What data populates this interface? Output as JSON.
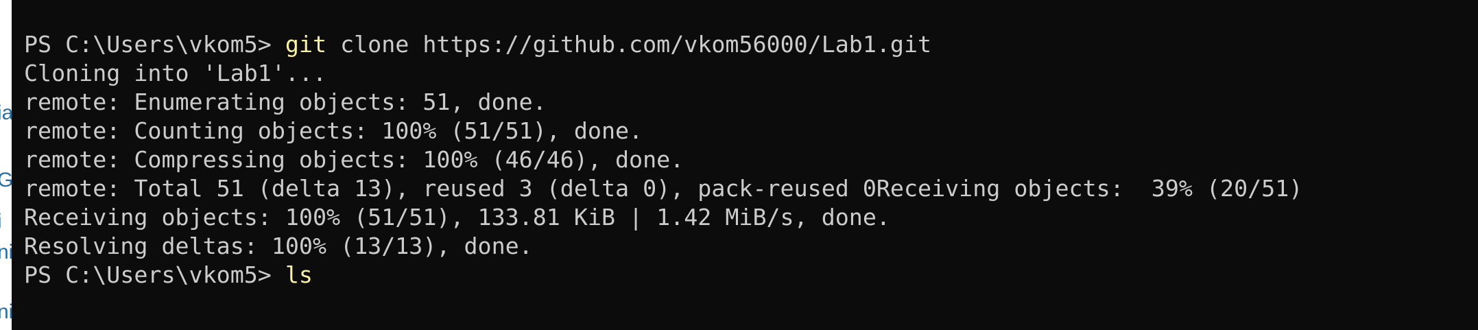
{
  "background_window": {
    "fragments": [
      "ia",
      "Ga",
      "i",
      "ni",
      "ni"
    ]
  },
  "terminal": {
    "prompt": "PS C:\\Users\\vkom5> ",
    "lines": [
      {
        "kind": "command",
        "program": "git",
        "args": " clone https://github.com/vkom56000/Lab1.git"
      },
      {
        "kind": "output",
        "text": "Cloning into 'Lab1'..."
      },
      {
        "kind": "output",
        "text": "remote: Enumerating objects: 51, done."
      },
      {
        "kind": "output",
        "text": "remote: Counting objects: 100% (51/51), done."
      },
      {
        "kind": "output",
        "text": "remote: Compressing objects: 100% (46/46), done."
      },
      {
        "kind": "output",
        "text": "remote: Total 51 (delta 13), reused 3 (delta 0), pack-reused 0Receiving objects:  39% (20/51)"
      },
      {
        "kind": "output",
        "text": "Receiving objects: 100% (51/51), 133.81 KiB | 1.42 MiB/s, done."
      },
      {
        "kind": "output",
        "text": "Resolving deltas: 100% (13/13), done."
      },
      {
        "kind": "command",
        "program": "ls",
        "args": ""
      }
    ],
    "colors": {
      "background": "#0c0c0c",
      "text": "#cccccc",
      "command": "#f9f1a5"
    }
  }
}
